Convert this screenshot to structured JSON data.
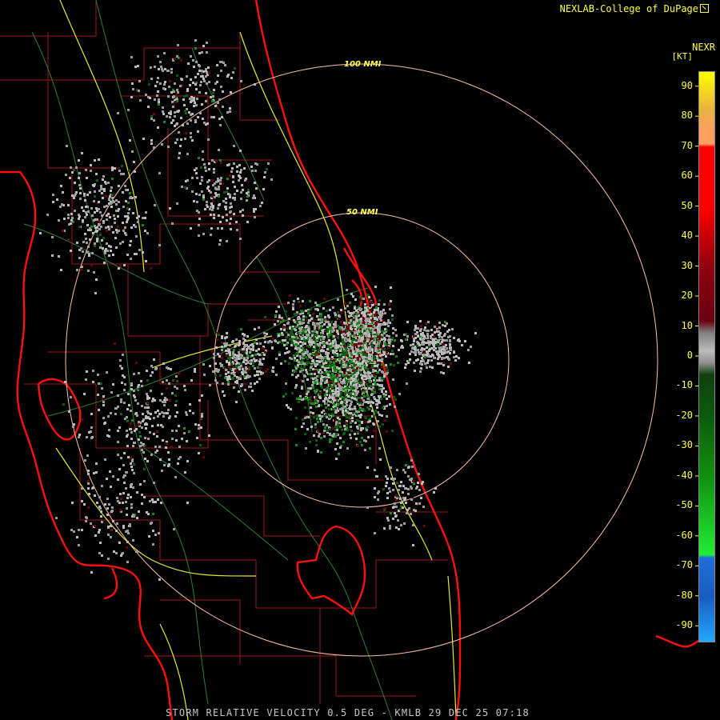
{
  "header": {
    "credit": "NEXLAB-College of DuPage",
    "logo_icon": "cod-logo-icon"
  },
  "legend": {
    "name": "NEXR",
    "unit": "[KT]",
    "ticks": [
      "90",
      "80",
      "70",
      "60",
      "50",
      "40",
      "30",
      "20",
      "10",
      "0",
      "-10",
      "-20",
      "-30",
      "-40",
      "-50",
      "-60",
      "-70",
      "-80",
      "-90"
    ],
    "range": [
      -95,
      95
    ],
    "colors": {
      "max": "#ffff00",
      "high": "#ffa060",
      "red": "#ff0000",
      "darkred": "#6a0010",
      "gray": "#bcbcbc",
      "darkgreen": "#0d5c0d",
      "green": "#22ee33",
      "blue": "#1f6fd8",
      "lightblue": "#22a8ff"
    }
  },
  "rings": [
    {
      "label": "50 NMI"
    },
    {
      "label": "100 NMI"
    }
  ],
  "footer": {
    "product": "STORM RELATIVE VELOCITY 0.5 DEG - KMLB 29 DEC 25 07:18"
  },
  "map_colors": {
    "coast": "#ff1010",
    "county": "#a01818",
    "road": "#66cc66",
    "highway": "#ffff33",
    "ring": "#ffbfa0"
  }
}
